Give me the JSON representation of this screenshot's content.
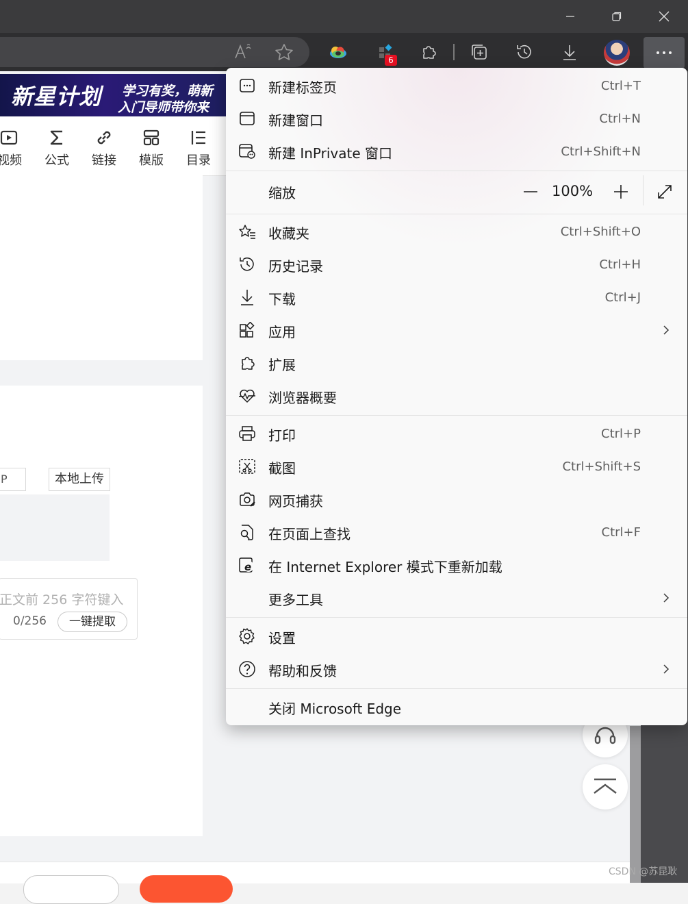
{
  "window": {
    "minimize_icon": "minimize-icon",
    "restore_icon": "restore-icon",
    "close_icon": "close-icon"
  },
  "toolbar": {
    "read_aloud_icon": "read-aloud-icon",
    "favorite_icon": "star-icon",
    "extension_badge": "6",
    "more_icon": "ellipsis-icon"
  },
  "page": {
    "banner": {
      "main": "新星计划",
      "sub1": "学习有奖，萌新",
      "sub2": "入门导师带你来"
    },
    "editor_tools": [
      {
        "label": "视频",
        "icon": "video-icon"
      },
      {
        "label": "公式",
        "icon": "sigma-icon"
      },
      {
        "label": "链接",
        "icon": "link-icon"
      },
      {
        "label": "模版",
        "icon": "template-icon"
      },
      {
        "label": "目录",
        "icon": "toc-icon"
      }
    ],
    "small_box_text": "P",
    "upload_label": "本地上传",
    "abstract_placeholder": "正文前 256 字符键入",
    "counter": "0/256",
    "extract_label": "一键提取",
    "watermark": "CSDN @苏昆耿"
  },
  "menu": {
    "new_tab": {
      "label": "新建标签页",
      "shortcut": "Ctrl+T"
    },
    "new_window": {
      "label": "新建窗口",
      "shortcut": "Ctrl+N"
    },
    "new_inprivate": {
      "label": "新建 InPrivate 窗口",
      "shortcut": "Ctrl+Shift+N"
    },
    "zoom": {
      "label": "缩放",
      "value": "100%"
    },
    "favorites": {
      "label": "收藏夹",
      "shortcut": "Ctrl+Shift+O"
    },
    "history": {
      "label": "历史记录",
      "shortcut": "Ctrl+H"
    },
    "downloads": {
      "label": "下载",
      "shortcut": "Ctrl+J"
    },
    "apps": {
      "label": "应用"
    },
    "extensions": {
      "label": "扩展"
    },
    "browser_essentials": {
      "label": "浏览器概要"
    },
    "print": {
      "label": "打印",
      "shortcut": "Ctrl+P"
    },
    "screenshot": {
      "label": "截图",
      "shortcut": "Ctrl+Shift+S"
    },
    "web_capture": {
      "label": "网页捕获"
    },
    "find_on_page": {
      "label": "在页面上查找",
      "shortcut": "Ctrl+F"
    },
    "ie_mode": {
      "label": "在 Internet Explorer 模式下重新加载"
    },
    "more_tools": {
      "label": "更多工具"
    },
    "settings": {
      "label": "设置"
    },
    "help": {
      "label": "帮助和反馈"
    },
    "close_edge": {
      "label": "关闭 Microsoft Edge"
    }
  },
  "colors": {
    "titlebar": "#3b3b3d",
    "toolbar": "#2e2e30",
    "menu_bg": "#f9f9f9",
    "accent_red": "#fc5531",
    "badge_red": "#e81123"
  }
}
